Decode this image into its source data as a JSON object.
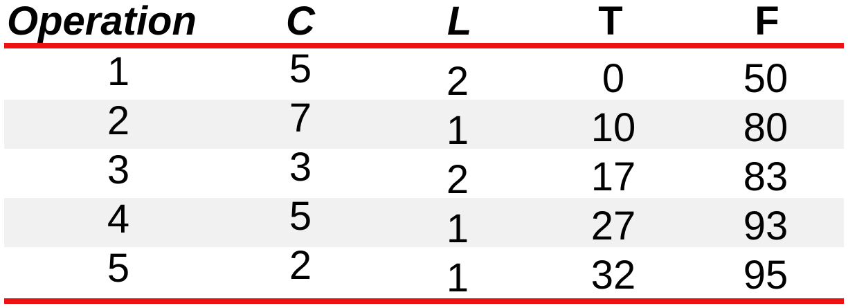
{
  "table": {
    "headers": {
      "operation": "Operation",
      "c": "C",
      "l": "L",
      "t": "T",
      "f": "F"
    },
    "rows": [
      {
        "operation": "1",
        "c": "5",
        "l": "2",
        "t": "0",
        "f": "50"
      },
      {
        "operation": "2",
        "c": "7",
        "l": "1",
        "t": "10",
        "f": "80"
      },
      {
        "operation": "3",
        "c": "3",
        "l": "2",
        "t": "17",
        "f": "83"
      },
      {
        "operation": "4",
        "c": "5",
        "l": "1",
        "t": "27",
        "f": "93"
      },
      {
        "operation": "5",
        "c": "2",
        "l": "1",
        "t": "32",
        "f": "95"
      }
    ]
  },
  "colors": {
    "rule": "#ee1111",
    "shaded_row": "#f1f1f1",
    "text": "#000000"
  }
}
